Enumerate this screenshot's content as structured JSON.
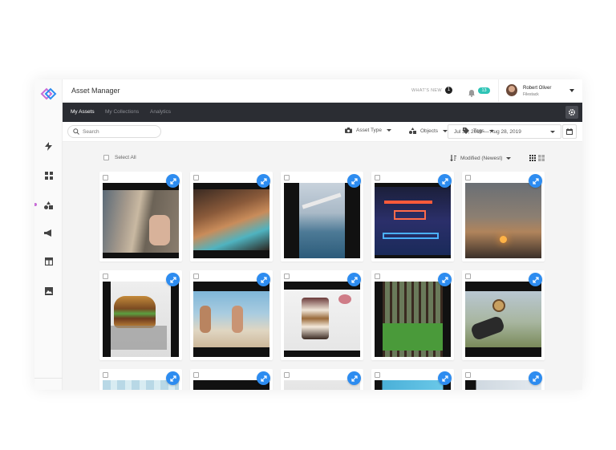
{
  "app": {
    "title": "Asset Manager"
  },
  "header": {
    "whats_new": "WHAT'S NEW",
    "whats_new_count": "1",
    "notifications_count": "13",
    "user": {
      "name": "Robert Oliver",
      "org": "Filestack"
    }
  },
  "nav": {
    "tabs": [
      {
        "label": "My Assets",
        "active": true
      },
      {
        "label": "My Collections",
        "active": false
      },
      {
        "label": "Analytics",
        "active": false
      }
    ]
  },
  "filters": {
    "search_placeholder": "Search",
    "asset_type": "Asset Type",
    "objects": "Objects",
    "tags": "Tags",
    "date_range": "Jul 30, 2019 — Aug 28, 2019"
  },
  "toolbar": {
    "select_all": "Select All",
    "sort": "Modified (Newest)"
  },
  "colors": {
    "accent": "#2d8cf0",
    "nav_bg": "#2b2d33",
    "badge": "#2ec4b6",
    "brand_purple": "#c86dd7"
  },
  "icons": {
    "sidebar": [
      "bolt-icon",
      "grid-icon",
      "shapes-icon",
      "megaphone-icon",
      "layout-icon",
      "image-icon"
    ]
  },
  "assets": [
    {
      "subject": "street-sketch"
    },
    {
      "subject": "coastal-cliffs"
    },
    {
      "subject": "airplane-wing"
    },
    {
      "subject": "neon-eat-drink"
    },
    {
      "subject": "sunset"
    },
    {
      "subject": "burger"
    },
    {
      "subject": "beach-hands"
    },
    {
      "subject": "dessert-cup"
    },
    {
      "subject": "forest"
    },
    {
      "subject": "compass-hand"
    },
    {
      "subject": "partial-1"
    },
    {
      "subject": "partial-2"
    },
    {
      "subject": "partial-3"
    },
    {
      "subject": "partial-4"
    },
    {
      "subject": "partial-5"
    }
  ]
}
